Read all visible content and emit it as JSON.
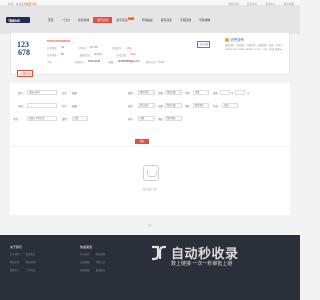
{
  "topbar": {
    "welcome": "您好！欢迎来到",
    "site": "我要号码",
    "links": [
      "我的订单",
      "买家中心",
      "商家中心",
      "联系客服"
    ]
  },
  "logo": {
    "text": "NOME",
    "accent": "号码"
  },
  "nav": {
    "items": [
      "首页",
      "一口价",
      "商标商城",
      "靓号商城",
      "选号买卖",
      "号码拍卖",
      "靓号商家",
      "号码回收",
      "号码求购"
    ],
    "active_index": 3,
    "badge": "HOT"
  },
  "product": {
    "number_line1": "123",
    "number_line2": "678",
    "title": "57879797990090",
    "favorite": "☆ 收藏店铺",
    "follow": "关注店铺",
    "rows": [
      {
        "label": "信誉等级：",
        "value": "5★",
        "label2": "好评率：",
        "value2": "96.73%",
        "label3": "店铺评分：",
        "value3": "4.9分"
      },
      {
        "label": "信誉等级：",
        "value": "SY",
        "label2": "最新成交：",
        "value2": "96.73%",
        "label3": "总成交量：",
        "value3": "1000"
      },
      {
        "label": "手机：",
        "value": "",
        "label2": "QQ：",
        "value2": "",
        "label3": "",
        "value3": ""
      },
      {
        "label": "",
        "value": "",
        "label2": "注册时间：",
        "value2": "2015-08-31",
        "label3": "邮箱：",
        "value3": "123456555@qq.com"
      }
    ],
    "extra": "联系电话：57859"
  },
  "merchant": {
    "title": "信誉靓号",
    "desc": "诚信经营，专业服务，号码齐全，欢迎选购。电话：678679, 789789, 999, 88888, 999999, 112211, 7758, 1号店, 联系qq"
  },
  "filter": {
    "labels": {
      "number": "靓号：",
      "price": "价格：",
      "type": "类型：",
      "digits": "位数：",
      "exclude": "不含：",
      "sort": "排序：",
      "area": "地区：",
      "status": "状态："
    },
    "placeholders": {
      "number": "请输入靓号",
      "price_from": "开头",
      "price_to": "结尾",
      "digits_input": "请输入号码包含"
    },
    "selects": {
      "type": "所有类别",
      "digits": "所有位数",
      "digits2": "所有位数",
      "exclude": "不限",
      "sort": "默认排序",
      "area": "所有地区",
      "status": "全部"
    },
    "texts": {
      "to": "至",
      "unit": "元",
      "price_to_label": "价格"
    },
    "search": "搜索"
  },
  "results": {
    "empty": "暂无相关号码"
  },
  "pager": "暂无",
  "footer": {
    "col1": {
      "title": "关于我们",
      "links": [
        "关于我们",
        "联系我们",
        "网站合作",
        "网站声明",
        "帮助中心",
        "工作机会"
      ]
    },
    "col2": {
      "title": "快速通道",
      "links": [
        "开店流程",
        "购买流程",
        "交易保障",
        "付款方式",
        "卖家须知",
        "投诉建议"
      ]
    },
    "watermark_big": "自动秒收录",
    "watermark_small": "数上链接 一次一秒审批上链"
  }
}
